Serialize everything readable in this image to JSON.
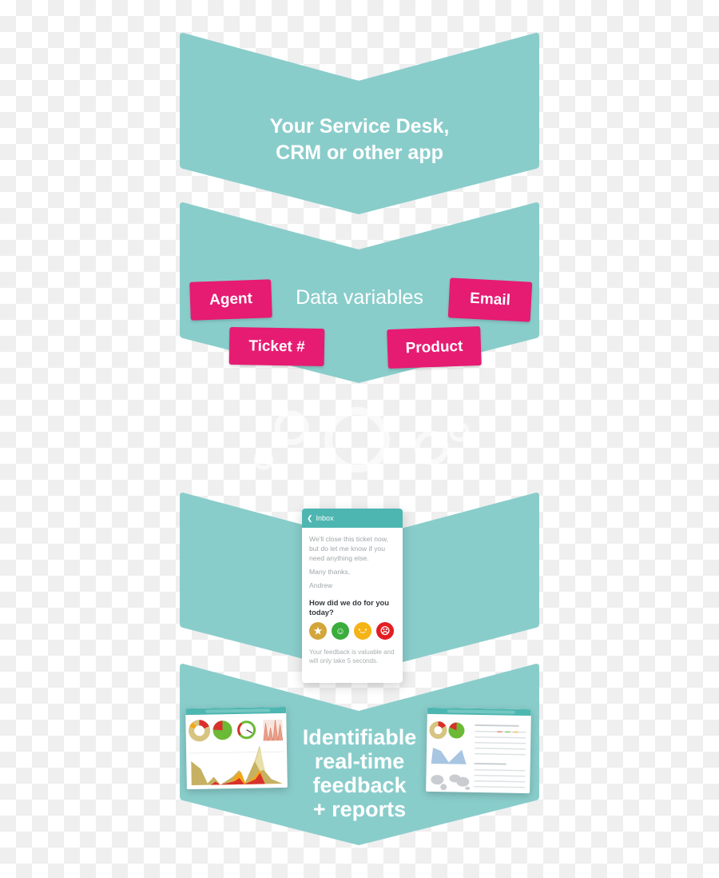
{
  "colors": {
    "chevron": "#89cdcb",
    "tag": "#e61b72",
    "phone_header": "#4db6b0",
    "face_star": "#d3a53a",
    "face_happy": "#3aad3c",
    "face_neutral": "#f4b416",
    "face_sad": "#e31d22"
  },
  "steps": [
    {
      "title_line1": "Your Service Desk,",
      "title_line2": "CRM or other app"
    },
    {
      "title": "Data variables"
    },
    {
      "title": ""
    },
    {
      "title_lines": [
        "Identifiable",
        "real-time",
        "feedback",
        "+ reports"
      ]
    }
  ],
  "tags": [
    {
      "label": "Agent"
    },
    {
      "label": "Email"
    },
    {
      "label": "Ticket #"
    },
    {
      "label": "Product"
    }
  ],
  "phone": {
    "header_icon": "chevron-left-icon",
    "header_label": "Inbox",
    "message": "We'll close this ticket now, but do let me know if you need anything else.",
    "signoff": "Many thanks,",
    "signature": "Andrew",
    "question": "How did we do for you today?",
    "ratings": [
      {
        "name": "star-rating-icon",
        "glyph": "★"
      },
      {
        "name": "happy-face-icon",
        "glyph": "☺"
      },
      {
        "name": "neutral-face-icon",
        "glyph": "•‿•"
      },
      {
        "name": "sad-face-icon",
        "glyph": "☹"
      }
    ],
    "footer": "Your feedback is valuable and will only take 5 seconds."
  },
  "dashboards": [
    {
      "name": "satisfaction-dashboard"
    },
    {
      "name": "reports-dashboard"
    }
  ]
}
